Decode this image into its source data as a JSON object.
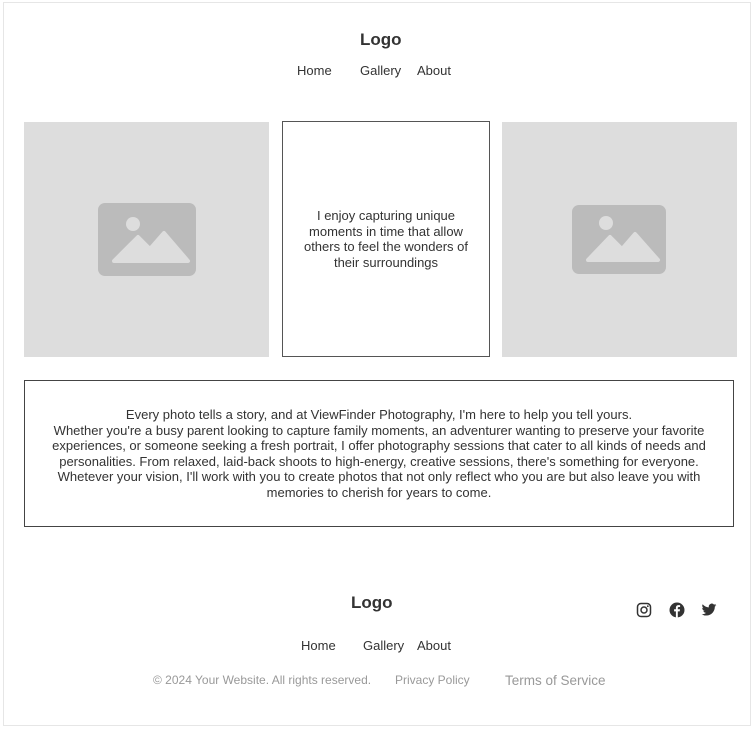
{
  "header": {
    "logo": "Logo",
    "nav": [
      "Home",
      "Gallery",
      "About"
    ]
  },
  "about_card": {
    "text": "I enjoy capturing unique moments in time that allow others to feel the wonders of their surroundings"
  },
  "story": {
    "line1": "Every photo tells a story, and at ViewFinder Photography, I'm here to help you tell yours.",
    "line2": "Whether you're a busy parent looking to capture family moments, an adventurer wanting to preserve your favorite experiences, or someone seeking a fresh portrait, I offer photography sessions that cater to all kinds of needs and personalities. From relaxed, laid-back shoots to high-energy, creative sessions, there's something for everyone. Whetever your vision, I'll work with you to create photos that not only reflect who you are but also leave you with memories to cherish for years to come."
  },
  "footer": {
    "logo": "Logo",
    "nav": [
      "Home",
      "Gallery",
      "About"
    ],
    "copyright": "© 2024 Your Website. All rights reserved.",
    "privacy": "Privacy Policy",
    "terms": "Terms of Service",
    "social_icons": [
      "instagram-icon",
      "facebook-icon",
      "twitter-icon"
    ]
  },
  "colors": {
    "placeholder_bg": "#dddddd",
    "placeholder_icon": "#bbbbbb",
    "muted_text": "#999999"
  }
}
